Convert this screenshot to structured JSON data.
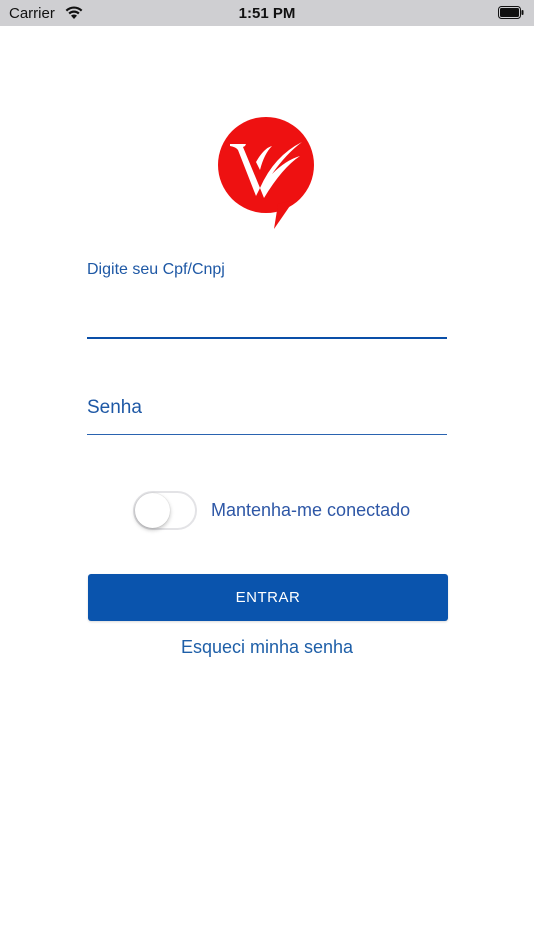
{
  "status_bar": {
    "carrier": "Carrier",
    "time": "1:51 PM"
  },
  "logo": {
    "icon": "brand-v-logo-icon",
    "color": "#ee1111"
  },
  "form": {
    "cpf_label": "Digite seu Cpf/Cnpj",
    "cpf_value": "",
    "password_placeholder": "Senha",
    "remember_label": "Mantenha-me conectado",
    "remember_on": false,
    "submit_label": "ENTRAR",
    "forgot_label": "Esqueci minha senha"
  },
  "colors": {
    "primary": "#0a54ad",
    "text_link": "#1e5fa8",
    "brand_red": "#ee1111"
  }
}
